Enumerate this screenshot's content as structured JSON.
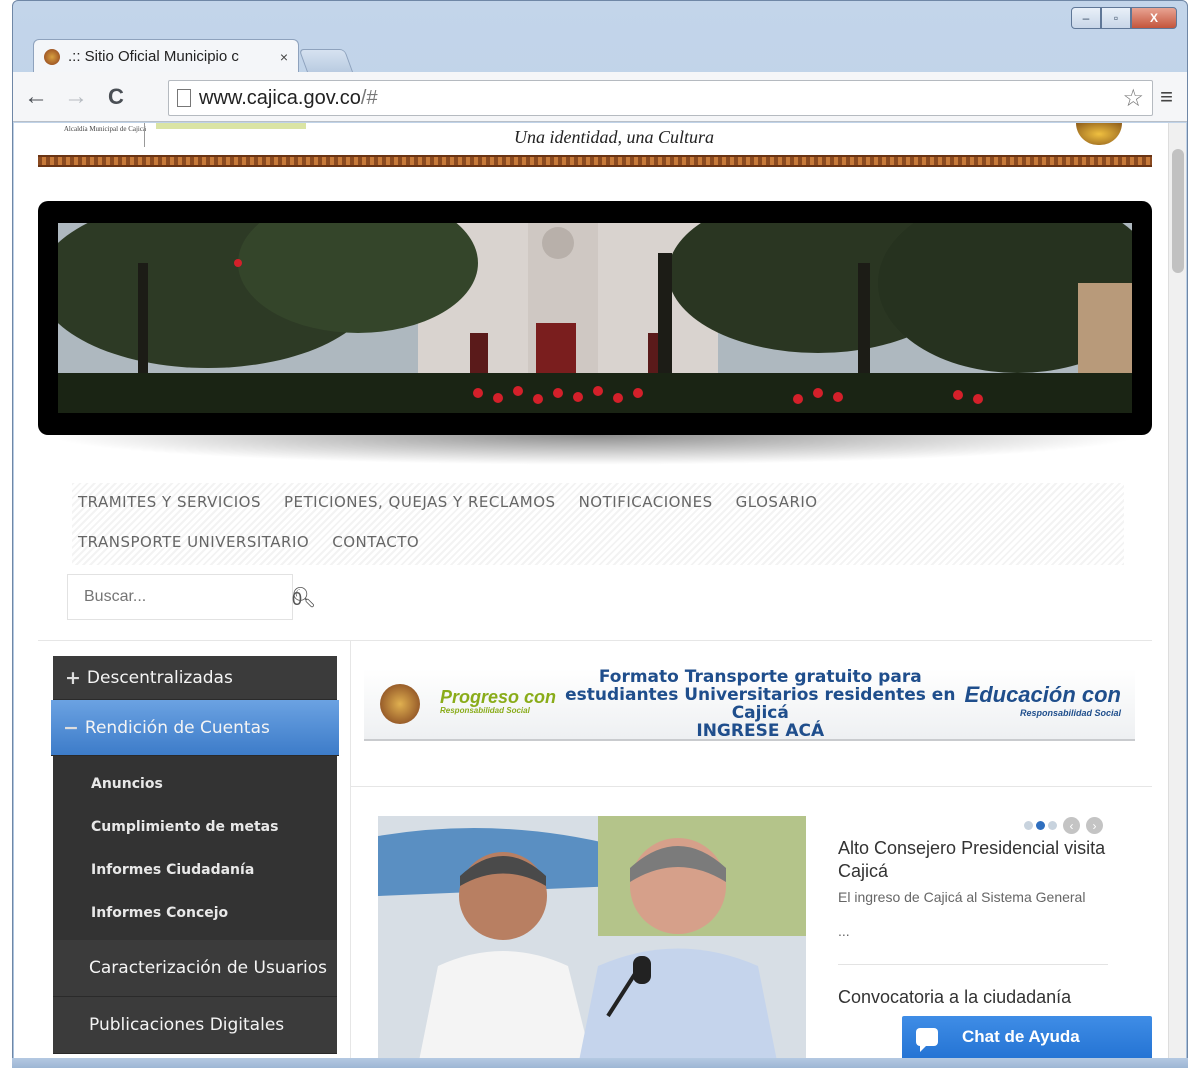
{
  "browser": {
    "tab_title": ".:: Sitio Oficial Municipio c",
    "tab_close": "×",
    "url_host": "www.cajica.gov.co",
    "url_path": "/#",
    "back": "←",
    "forward": "→",
    "reload": "C",
    "star": "☆",
    "menu": "≡",
    "win_min": "‒",
    "win_max": "▫",
    "win_close": "X"
  },
  "header": {
    "logo_text": "Alcaldía Municipal de Cajicá",
    "tagline": "Una identidad, una Cultura"
  },
  "nav": {
    "row1": [
      "TRAMITES Y SERVICIOS",
      "PETICIONES, QUEJAS Y RECLAMOS",
      "NOTIFICACIONES",
      "GLOSARIO"
    ],
    "row2": [
      "TRANSPORTE UNIVERSITARIO",
      "CONTACTO"
    ]
  },
  "search": {
    "placeholder": "Buscar...",
    "count": "0"
  },
  "sidebar": {
    "descentralizadas": "Descentralizadas",
    "rendicion": "Rendición de Cuentas",
    "sub": [
      "Anuncios",
      "Cumplimiento de metas",
      "Informes Ciudadanía",
      "Informes Concejo"
    ],
    "caracterizacion": "Caracterización de Usuarios",
    "publicaciones": "Publicaciones Digitales"
  },
  "promo": {
    "progreso": "Progreso con",
    "progreso_sub": "Responsabilidad Social",
    "line1": "Formato Transporte gratuito para",
    "line2": "estudiantes Universitarios residentes en Cajicá",
    "cta": "INGRESE ACÁ",
    "educacion": "Educación con",
    "educacion_sub": "Responsabilidad Social"
  },
  "news": {
    "title": "Alto Consejero Presidencial visita Cajicá",
    "excerpt": "El ingreso de Cajicá al Sistema General",
    "more": "...",
    "title2": "Convocatoria a la ciudadanía"
  },
  "chat": {
    "label": "Chat de Ayuda"
  }
}
